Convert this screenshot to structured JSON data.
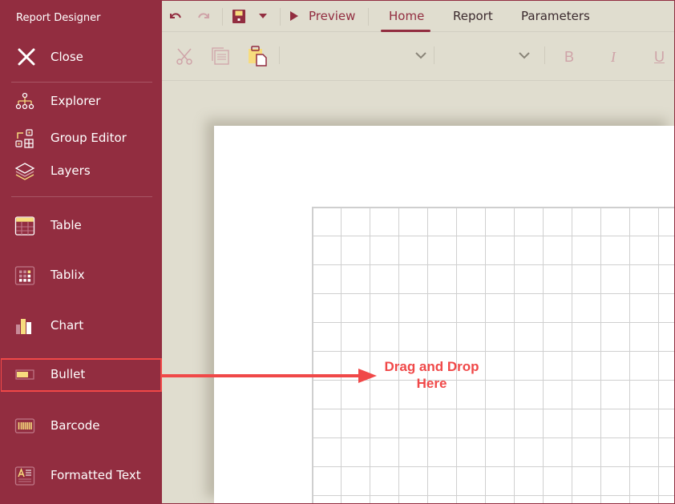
{
  "app": {
    "title": "Report Designer"
  },
  "sidebar": {
    "close_label": "Close",
    "items": [
      {
        "label": "Explorer",
        "icon": "explorer-tree-icon"
      },
      {
        "label": "Group Editor",
        "icon": "group-editor-icon"
      },
      {
        "label": "Layers",
        "icon": "layers-icon"
      },
      {
        "label": "Table",
        "icon": "table-icon"
      },
      {
        "label": "Tablix",
        "icon": "tablix-icon"
      },
      {
        "label": "Chart",
        "icon": "chart-icon"
      },
      {
        "label": "Bullet",
        "icon": "bullet-icon",
        "highlighted": true
      },
      {
        "label": "Barcode",
        "icon": "barcode-icon"
      },
      {
        "label": "Formatted Text",
        "icon": "formatted-text-icon"
      }
    ]
  },
  "toolbar": {
    "undo": "undo-icon",
    "redo": "redo-icon",
    "save": "save-icon",
    "save_dropdown": "caret-down-icon",
    "preview_label": "Preview",
    "tabs": [
      {
        "label": "Home",
        "active": true
      },
      {
        "label": "Report",
        "active": false
      },
      {
        "label": "Parameters",
        "active": false
      }
    ],
    "clipboard": [
      "cut-icon",
      "copy-icon",
      "paste-icon"
    ],
    "font_family_value": "",
    "font_size_value": "",
    "format": {
      "bold": "B",
      "italic": "I",
      "underline": "U"
    }
  },
  "annotation": {
    "text": "Drag and Drop Here",
    "color": "#f04848"
  },
  "colors": {
    "accent": "#922d40",
    "icon_yellow": "#f7dc7e",
    "canvas": "#e0ddcf"
  }
}
